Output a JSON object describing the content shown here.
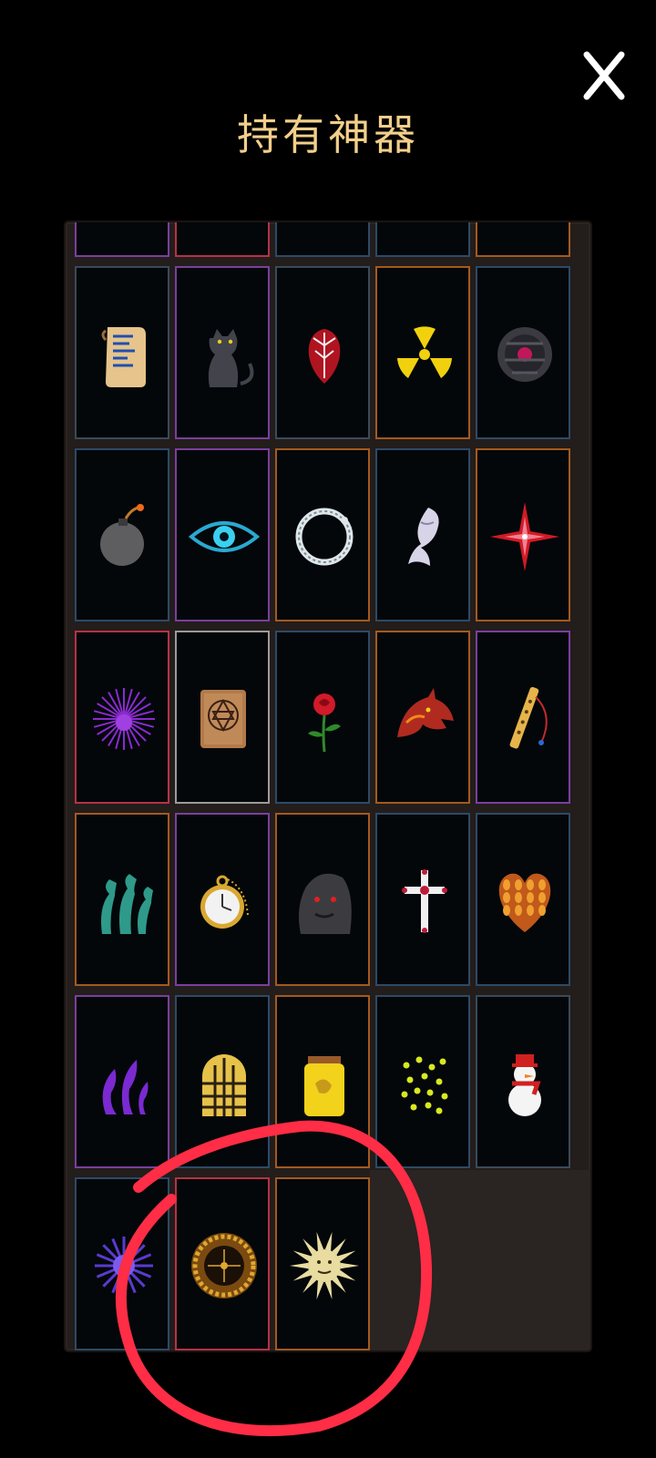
{
  "header": {
    "title": "持有神器",
    "close_label": "X"
  },
  "colors": {
    "background": "#000000",
    "title": "#f2cf8a",
    "panel": "#231d1b",
    "annotation": "#ff2d45"
  },
  "artifacts": [
    {
      "row": 0,
      "col": 0,
      "icon": "partial-card",
      "frame": "#7a3f9e"
    },
    {
      "row": 0,
      "col": 1,
      "icon": "partial-card",
      "frame": "#b63247"
    },
    {
      "row": 0,
      "col": 2,
      "icon": "partial-card",
      "frame": "#2d4a66"
    },
    {
      "row": 0,
      "col": 3,
      "icon": "partial-card",
      "frame": "#2d4a66"
    },
    {
      "row": 0,
      "col": 4,
      "icon": "partial-card",
      "frame": "#a35a1f"
    },
    {
      "row": 1,
      "col": 0,
      "icon": "scroll-icon",
      "frame": "#3a4a5a"
    },
    {
      "row": 1,
      "col": 1,
      "icon": "black-cat-icon",
      "frame": "#7a3f9e"
    },
    {
      "row": 1,
      "col": 2,
      "icon": "bleeding-heart-icon",
      "frame": "#3a4a5a"
    },
    {
      "row": 1,
      "col": 3,
      "icon": "radiation-icon",
      "frame": "#a35a1f"
    },
    {
      "row": 1,
      "col": 4,
      "icon": "dark-orb-icon",
      "frame": "#2d4a66"
    },
    {
      "row": 2,
      "col": 0,
      "icon": "bomb-icon",
      "frame": "#2d4a66"
    },
    {
      "row": 2,
      "col": 1,
      "icon": "eye-icon",
      "frame": "#7a3f9e"
    },
    {
      "row": 2,
      "col": 2,
      "icon": "ouroboros-icon",
      "frame": "#a35a1f"
    },
    {
      "row": 2,
      "col": 3,
      "icon": "ghost-icon",
      "frame": "#2d4a66"
    },
    {
      "row": 2,
      "col": 4,
      "icon": "red-star-icon",
      "frame": "#a35a1f"
    },
    {
      "row": 3,
      "col": 0,
      "icon": "purple-burst-icon",
      "frame": "#b63247"
    },
    {
      "row": 3,
      "col": 1,
      "icon": "spellbook-icon",
      "frame": "#9a9a9a"
    },
    {
      "row": 3,
      "col": 2,
      "icon": "rose-icon",
      "frame": "#2d4a66"
    },
    {
      "row": 3,
      "col": 3,
      "icon": "dragon-head-icon",
      "frame": "#a35a1f"
    },
    {
      "row": 3,
      "col": 4,
      "icon": "flute-icon",
      "frame": "#7a3f9e"
    },
    {
      "row": 4,
      "col": 0,
      "icon": "hydra-icon",
      "frame": "#a35a1f"
    },
    {
      "row": 4,
      "col": 1,
      "icon": "pocket-watch-icon",
      "frame": "#7a3f9e"
    },
    {
      "row": 4,
      "col": 2,
      "icon": "stone-golem-icon",
      "frame": "#a35a1f"
    },
    {
      "row": 4,
      "col": 3,
      "icon": "cross-icon",
      "frame": "#2d4a66"
    },
    {
      "row": 4,
      "col": 4,
      "icon": "scaled-heart-icon",
      "frame": "#2d4a66"
    },
    {
      "row": 5,
      "col": 0,
      "icon": "tentacles-icon",
      "frame": "#7a3f9e"
    },
    {
      "row": 5,
      "col": 1,
      "icon": "stained-window-icon",
      "frame": "#2d4a66"
    },
    {
      "row": 5,
      "col": 2,
      "icon": "jar-icon",
      "frame": "#a35a1f"
    },
    {
      "row": 5,
      "col": 3,
      "icon": "spores-icon",
      "frame": "#2d4a66"
    },
    {
      "row": 5,
      "col": 4,
      "icon": "snowman-icon",
      "frame": "#3a4a5a"
    },
    {
      "row": 6,
      "col": 0,
      "icon": "spiky-orb-icon",
      "frame": "#2d4a66"
    },
    {
      "row": 6,
      "col": 1,
      "icon": "roulette-wheel-icon",
      "frame": "#b63247"
    },
    {
      "row": 6,
      "col": 2,
      "icon": "sun-icon",
      "frame": "#a35a1f"
    }
  ]
}
